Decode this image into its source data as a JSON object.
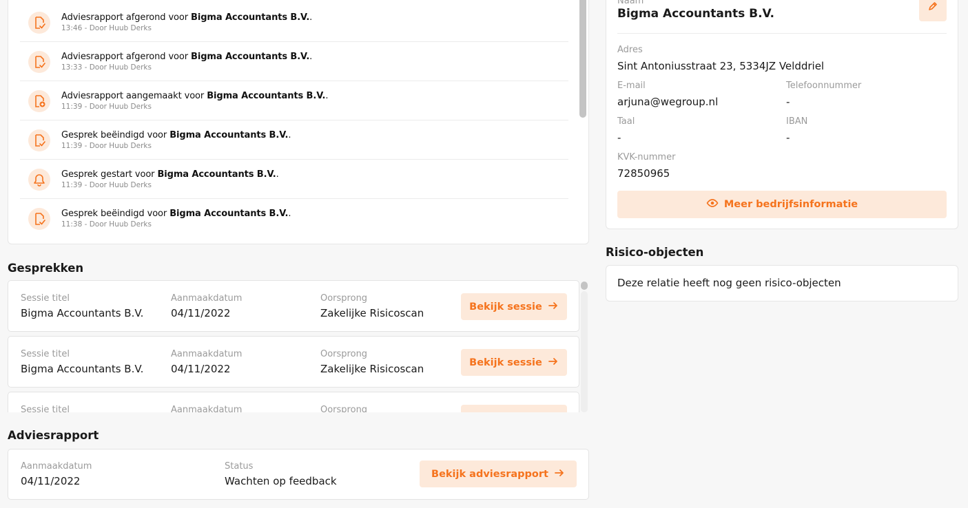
{
  "activity": {
    "items": [
      {
        "prefix": "Adviesrapport afgerond voor ",
        "company": "Bigma Accountants B.V.",
        "suffix": ".",
        "meta": "13:46 - Door Huub Derks",
        "icon": "document-check-icon"
      },
      {
        "prefix": "Adviesrapport afgerond voor ",
        "company": "Bigma Accountants B.V.",
        "suffix": ".",
        "meta": "13:33 - Door Huub Derks",
        "icon": "document-check-icon"
      },
      {
        "prefix": "Adviesrapport aangemaakt voor ",
        "company": "Bigma Accountants B.V.",
        "suffix": ".",
        "meta": "11:39 - Door Huub Derks",
        "icon": "document-add-icon"
      },
      {
        "prefix": "Gesprek beëindigd voor ",
        "company": "Bigma Accountants B.V.",
        "suffix": ".",
        "meta": "11:39 - Door Huub Derks",
        "icon": "document-check-icon"
      },
      {
        "prefix": "Gesprek gestart voor ",
        "company": "Bigma Accountants B.V.",
        "suffix": ".",
        "meta": "11:39 - Door Huub Derks",
        "icon": "bell-icon"
      },
      {
        "prefix": "Gesprek beëindigd voor ",
        "company": "Bigma Accountants B.V.",
        "suffix": ".",
        "meta": "11:38 - Door Huub Derks",
        "icon": "document-check-icon"
      }
    ]
  },
  "gesprekken": {
    "title": "Gesprekken",
    "label_title": "Sessie titel",
    "label_date": "Aanmaakdatum",
    "label_origin": "Oorsprong",
    "button_label": "Bekijk sessie",
    "sessions": [
      {
        "title": "Bigma Accountants B.V.",
        "date": "04/11/2022",
        "origin": "Zakelijke Risicoscan"
      },
      {
        "title": "Bigma Accountants B.V.",
        "date": "04/11/2022",
        "origin": "Zakelijke Risicoscan"
      },
      {
        "title": "",
        "date": "",
        "origin": ""
      }
    ]
  },
  "adviesrapport": {
    "title": "Adviesrapport",
    "label_date": "Aanmaakdatum",
    "date": "04/11/2022",
    "label_status": "Status",
    "status": "Wachten op feedback",
    "button_label": "Bekijk adviesrapport"
  },
  "company": {
    "name_label": "Naam",
    "name": "Bigma Accountants B.V.",
    "address_label": "Adres",
    "address": "Sint Antoniusstraat 23, 5334JZ Velddriel",
    "email_label": "E-mail",
    "email": "arjuna@wegroup.nl",
    "phone_label": "Telefoonnummer",
    "phone": "-",
    "language_label": "Taal",
    "language": "-",
    "iban_label": "IBAN",
    "iban": "-",
    "kvk_label": "KVK-nummer",
    "kvk": "72850965",
    "more_button": "Meer bedrijfsinformatie"
  },
  "risico": {
    "title": "Risico-objecten",
    "empty_text": "Deze relatie heeft nog geen risico-objecten"
  },
  "colors": {
    "accent": "#f5731d",
    "accent_bg": "#fde9da"
  }
}
